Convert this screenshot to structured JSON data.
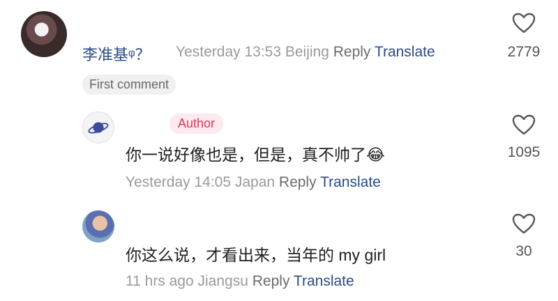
{
  "comments": [
    {
      "name": "李准基ᵠ？",
      "meta": "Yesterday 13:53 Beijing",
      "reply": "Reply",
      "translate": "Translate",
      "likes": "2779",
      "badge": "First comment"
    },
    {
      "tag": "Author",
      "text": "你一说好像也是，但是，真不帅了",
      "emoji": "😂",
      "meta": "Yesterday 14:05 Japan",
      "reply": "Reply",
      "translate": "Translate",
      "likes": "1095"
    },
    {
      "text": "你这么说，才看出来，当年的 my girl",
      "meta": "11 hrs ago Jiangsu",
      "reply": "Reply",
      "translate": "Translate",
      "likes": "30"
    }
  ],
  "icons": {
    "like": "heart-outline-icon"
  },
  "colors": {
    "link": "#2b4a85",
    "author": "#d13b5c",
    "muted": "#9a9a9a"
  }
}
